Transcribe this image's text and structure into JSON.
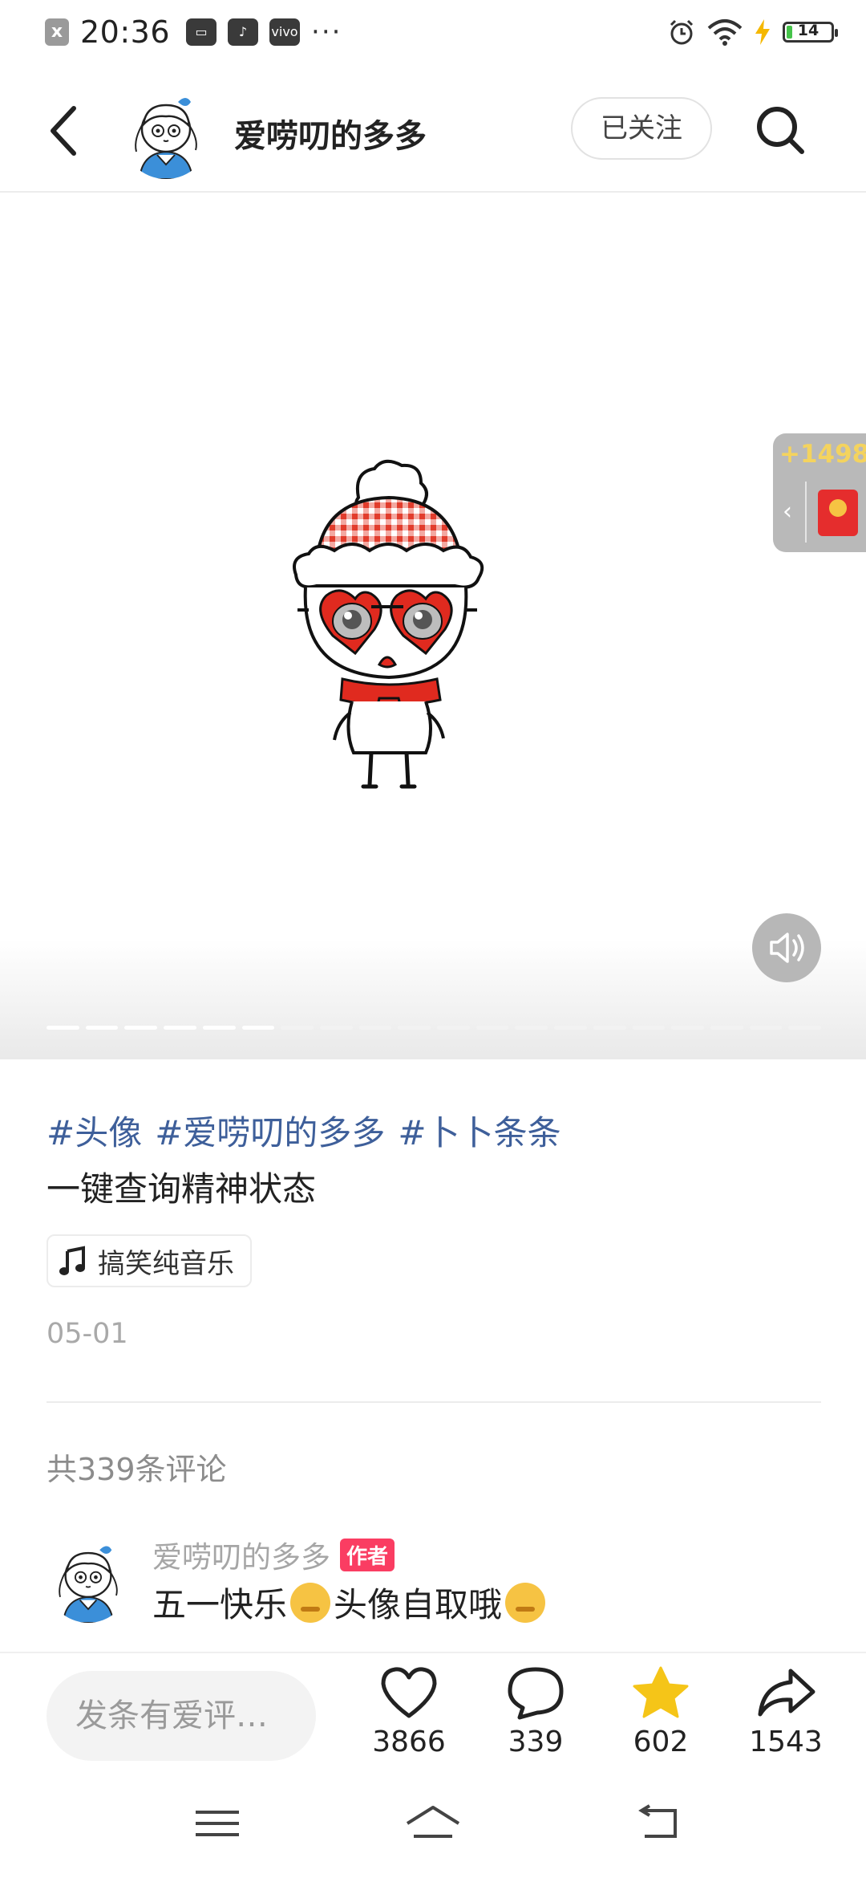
{
  "status_bar": {
    "time": "20:36",
    "notification_icon": "x",
    "app_icon_vivo": "vivo",
    "more": "···",
    "battery_level": "14",
    "icons": [
      "notification-icon",
      "card-icon",
      "tiktok-icon",
      "vivo-icon",
      "alarm-icon",
      "wifi-icon",
      "charging-icon",
      "battery-icon"
    ]
  },
  "header": {
    "author_name": "爱唠叨的多多",
    "follow_label": "已关注"
  },
  "media": {
    "reward_count": "+1498",
    "reward_arrow": "‹",
    "progress_segments": 20,
    "progress_filled": 6
  },
  "post": {
    "tags": [
      "#头像",
      "#爱唠叨的多多",
      "#卜卜条条"
    ],
    "description": "一键查询精神状态",
    "music": "搞笑纯音乐",
    "date": "05-01"
  },
  "comments": {
    "count_label": "共339条评论",
    "items": [
      {
        "user": "爱唠叨的多多",
        "badge": "作者",
        "text_part1": "五一快乐",
        "text_part2": "头像自取哦"
      }
    ]
  },
  "action_bar": {
    "input_placeholder": "发条有爱评…",
    "likes": "3866",
    "comments": "339",
    "favorites": "602",
    "shares": "1543"
  },
  "colors": {
    "tag": "#3e5f9a",
    "author_badge": "#fa3d62",
    "star": "#f5c518",
    "reward_text": "#f4d35e"
  }
}
